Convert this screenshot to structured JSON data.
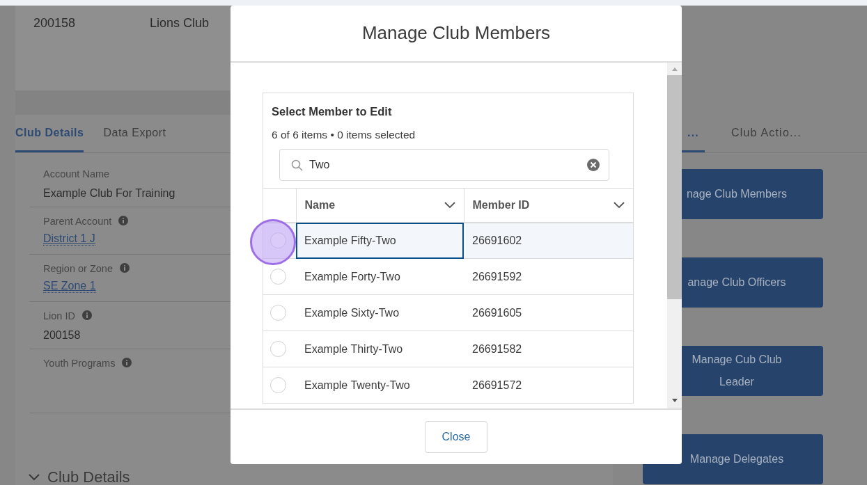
{
  "background": {
    "header_fields": [
      {
        "value": "200158"
      },
      {
        "value": "Lions Club"
      }
    ],
    "left_tabs": [
      {
        "label": "Club Details",
        "selected": true
      },
      {
        "label": "Data Export",
        "selected": false
      }
    ],
    "details": [
      {
        "label": "Account Name",
        "info": false,
        "kind": "text",
        "value": "Example Club For Training"
      },
      {
        "label": "Parent Account",
        "info": true,
        "kind": "link",
        "value": "District 1 J"
      },
      {
        "label": "Region or Zone",
        "info": true,
        "kind": "link",
        "value": "SE Zone 1"
      },
      {
        "label": "Lion ID",
        "info": true,
        "kind": "text",
        "value": "200158"
      },
      {
        "label": "Youth Programs",
        "info": true,
        "kind": "empty"
      }
    ],
    "section_header": {
      "label": "Club Details",
      "expanded": true
    },
    "right_tabs": [
      {
        "label": "...",
        "selected": true
      },
      {
        "label": "Club Actio...",
        "selected": false
      }
    ],
    "action_buttons": [
      "nage Club Members",
      "anage Club Officers",
      "Manage Cub Club Leader",
      "Manage Delegates"
    ]
  },
  "modal": {
    "title": "Manage Club Members",
    "list": {
      "title": "Select Member to Edit",
      "count": "6 of 6 items • 0 items selected",
      "search": {
        "value": "Two"
      },
      "columns": [
        "Name",
        "Member ID"
      ],
      "rows": [
        {
          "name": "Example Fifty-Two",
          "member_id": "26691602",
          "selected": false,
          "focused": true
        },
        {
          "name": "Example Forty-Two",
          "member_id": "26691592",
          "selected": false,
          "focused": false
        },
        {
          "name": "Example Sixty-Two",
          "member_id": "26691605",
          "selected": false,
          "focused": false
        },
        {
          "name": "Example Thirty-Two",
          "member_id": "26691582",
          "selected": false,
          "focused": false
        },
        {
          "name": "Example Twenty-Two",
          "member_id": "26691572",
          "selected": false,
          "focused": false
        }
      ]
    },
    "close_button": "Close"
  }
}
